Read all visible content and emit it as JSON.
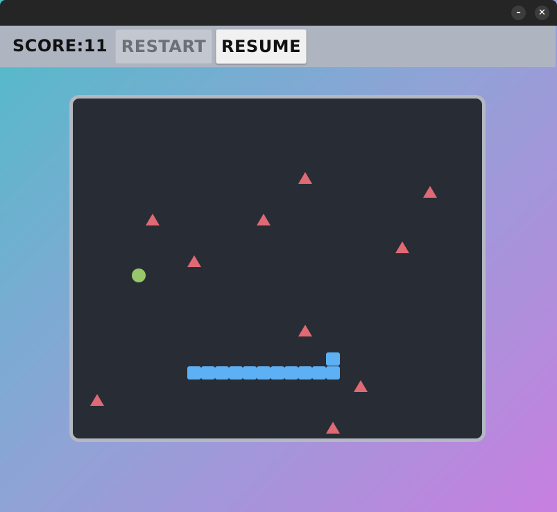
{
  "window": {
    "minimize_icon": "minimize-icon",
    "close_icon": "close-icon",
    "minimize_glyph": "–",
    "close_glyph": "✕"
  },
  "toolbar": {
    "score_label": "SCORE:11",
    "restart_label": "RESTART",
    "resume_label": "RESUME",
    "restart_enabled": false
  },
  "game": {
    "grid_cell": "20x20 units",
    "colors": {
      "board_background": "#282c35",
      "snake": "#5eb0f5",
      "food": "#98c76b",
      "obstacle": "#e06a74",
      "frame": "#b3b8c3",
      "background_gradient": [
        "#50bcc9",
        "#8fa3d6",
        "#c77fe0"
      ]
    },
    "snake": [
      {
        "col": 18,
        "row": 18
      },
      {
        "col": 18,
        "row": 19
      },
      {
        "col": 17,
        "row": 19
      },
      {
        "col": 16,
        "row": 19
      },
      {
        "col": 15,
        "row": 19
      },
      {
        "col": 14,
        "row": 19
      },
      {
        "col": 13,
        "row": 19
      },
      {
        "col": 12,
        "row": 19
      },
      {
        "col": 11,
        "row": 19
      },
      {
        "col": 10,
        "row": 19
      },
      {
        "col": 9,
        "row": 19
      },
      {
        "col": 8,
        "row": 19
      }
    ],
    "food": [
      {
        "col": 4,
        "row": 12
      }
    ],
    "obstacles": [
      {
        "col": 16,
        "row": 5
      },
      {
        "col": 25,
        "row": 6
      },
      {
        "col": 5,
        "row": 8
      },
      {
        "col": 13,
        "row": 8
      },
      {
        "col": 23,
        "row": 10
      },
      {
        "col": 8,
        "row": 11
      },
      {
        "col": 16,
        "row": 16
      },
      {
        "col": 20,
        "row": 20
      },
      {
        "col": 1,
        "row": 21
      },
      {
        "col": 18,
        "row": 23
      }
    ]
  }
}
